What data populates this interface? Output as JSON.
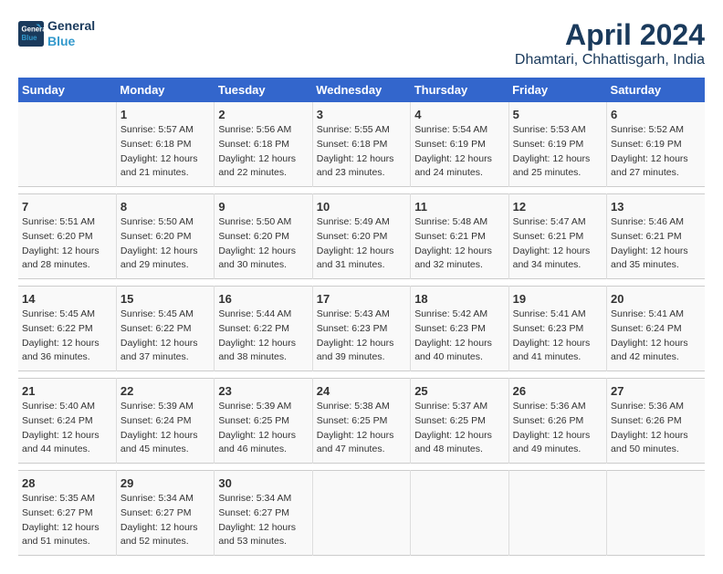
{
  "header": {
    "logo_line1": "General",
    "logo_line2": "Blue",
    "month": "April 2024",
    "location": "Dhamtari, Chhattisgarh, India"
  },
  "weekdays": [
    "Sunday",
    "Monday",
    "Tuesday",
    "Wednesday",
    "Thursday",
    "Friday",
    "Saturday"
  ],
  "weeks": [
    [
      {
        "day": "",
        "info": ""
      },
      {
        "day": "1",
        "info": "Sunrise: 5:57 AM\nSunset: 6:18 PM\nDaylight: 12 hours\nand 21 minutes."
      },
      {
        "day": "2",
        "info": "Sunrise: 5:56 AM\nSunset: 6:18 PM\nDaylight: 12 hours\nand 22 minutes."
      },
      {
        "day": "3",
        "info": "Sunrise: 5:55 AM\nSunset: 6:18 PM\nDaylight: 12 hours\nand 23 minutes."
      },
      {
        "day": "4",
        "info": "Sunrise: 5:54 AM\nSunset: 6:19 PM\nDaylight: 12 hours\nand 24 minutes."
      },
      {
        "day": "5",
        "info": "Sunrise: 5:53 AM\nSunset: 6:19 PM\nDaylight: 12 hours\nand 25 minutes."
      },
      {
        "day": "6",
        "info": "Sunrise: 5:52 AM\nSunset: 6:19 PM\nDaylight: 12 hours\nand 27 minutes."
      }
    ],
    [
      {
        "day": "7",
        "info": "Sunrise: 5:51 AM\nSunset: 6:20 PM\nDaylight: 12 hours\nand 28 minutes."
      },
      {
        "day": "8",
        "info": "Sunrise: 5:50 AM\nSunset: 6:20 PM\nDaylight: 12 hours\nand 29 minutes."
      },
      {
        "day": "9",
        "info": "Sunrise: 5:50 AM\nSunset: 6:20 PM\nDaylight: 12 hours\nand 30 minutes."
      },
      {
        "day": "10",
        "info": "Sunrise: 5:49 AM\nSunset: 6:20 PM\nDaylight: 12 hours\nand 31 minutes."
      },
      {
        "day": "11",
        "info": "Sunrise: 5:48 AM\nSunset: 6:21 PM\nDaylight: 12 hours\nand 32 minutes."
      },
      {
        "day": "12",
        "info": "Sunrise: 5:47 AM\nSunset: 6:21 PM\nDaylight: 12 hours\nand 34 minutes."
      },
      {
        "day": "13",
        "info": "Sunrise: 5:46 AM\nSunset: 6:21 PM\nDaylight: 12 hours\nand 35 minutes."
      }
    ],
    [
      {
        "day": "14",
        "info": "Sunrise: 5:45 AM\nSunset: 6:22 PM\nDaylight: 12 hours\nand 36 minutes."
      },
      {
        "day": "15",
        "info": "Sunrise: 5:45 AM\nSunset: 6:22 PM\nDaylight: 12 hours\nand 37 minutes."
      },
      {
        "day": "16",
        "info": "Sunrise: 5:44 AM\nSunset: 6:22 PM\nDaylight: 12 hours\nand 38 minutes."
      },
      {
        "day": "17",
        "info": "Sunrise: 5:43 AM\nSunset: 6:23 PM\nDaylight: 12 hours\nand 39 minutes."
      },
      {
        "day": "18",
        "info": "Sunrise: 5:42 AM\nSunset: 6:23 PM\nDaylight: 12 hours\nand 40 minutes."
      },
      {
        "day": "19",
        "info": "Sunrise: 5:41 AM\nSunset: 6:23 PM\nDaylight: 12 hours\nand 41 minutes."
      },
      {
        "day": "20",
        "info": "Sunrise: 5:41 AM\nSunset: 6:24 PM\nDaylight: 12 hours\nand 42 minutes."
      }
    ],
    [
      {
        "day": "21",
        "info": "Sunrise: 5:40 AM\nSunset: 6:24 PM\nDaylight: 12 hours\nand 44 minutes."
      },
      {
        "day": "22",
        "info": "Sunrise: 5:39 AM\nSunset: 6:24 PM\nDaylight: 12 hours\nand 45 minutes."
      },
      {
        "day": "23",
        "info": "Sunrise: 5:39 AM\nSunset: 6:25 PM\nDaylight: 12 hours\nand 46 minutes."
      },
      {
        "day": "24",
        "info": "Sunrise: 5:38 AM\nSunset: 6:25 PM\nDaylight: 12 hours\nand 47 minutes."
      },
      {
        "day": "25",
        "info": "Sunrise: 5:37 AM\nSunset: 6:25 PM\nDaylight: 12 hours\nand 48 minutes."
      },
      {
        "day": "26",
        "info": "Sunrise: 5:36 AM\nSunset: 6:26 PM\nDaylight: 12 hours\nand 49 minutes."
      },
      {
        "day": "27",
        "info": "Sunrise: 5:36 AM\nSunset: 6:26 PM\nDaylight: 12 hours\nand 50 minutes."
      }
    ],
    [
      {
        "day": "28",
        "info": "Sunrise: 5:35 AM\nSunset: 6:27 PM\nDaylight: 12 hours\nand 51 minutes."
      },
      {
        "day": "29",
        "info": "Sunrise: 5:34 AM\nSunset: 6:27 PM\nDaylight: 12 hours\nand 52 minutes."
      },
      {
        "day": "30",
        "info": "Sunrise: 5:34 AM\nSunset: 6:27 PM\nDaylight: 12 hours\nand 53 minutes."
      },
      {
        "day": "",
        "info": ""
      },
      {
        "day": "",
        "info": ""
      },
      {
        "day": "",
        "info": ""
      },
      {
        "day": "",
        "info": ""
      }
    ]
  ]
}
